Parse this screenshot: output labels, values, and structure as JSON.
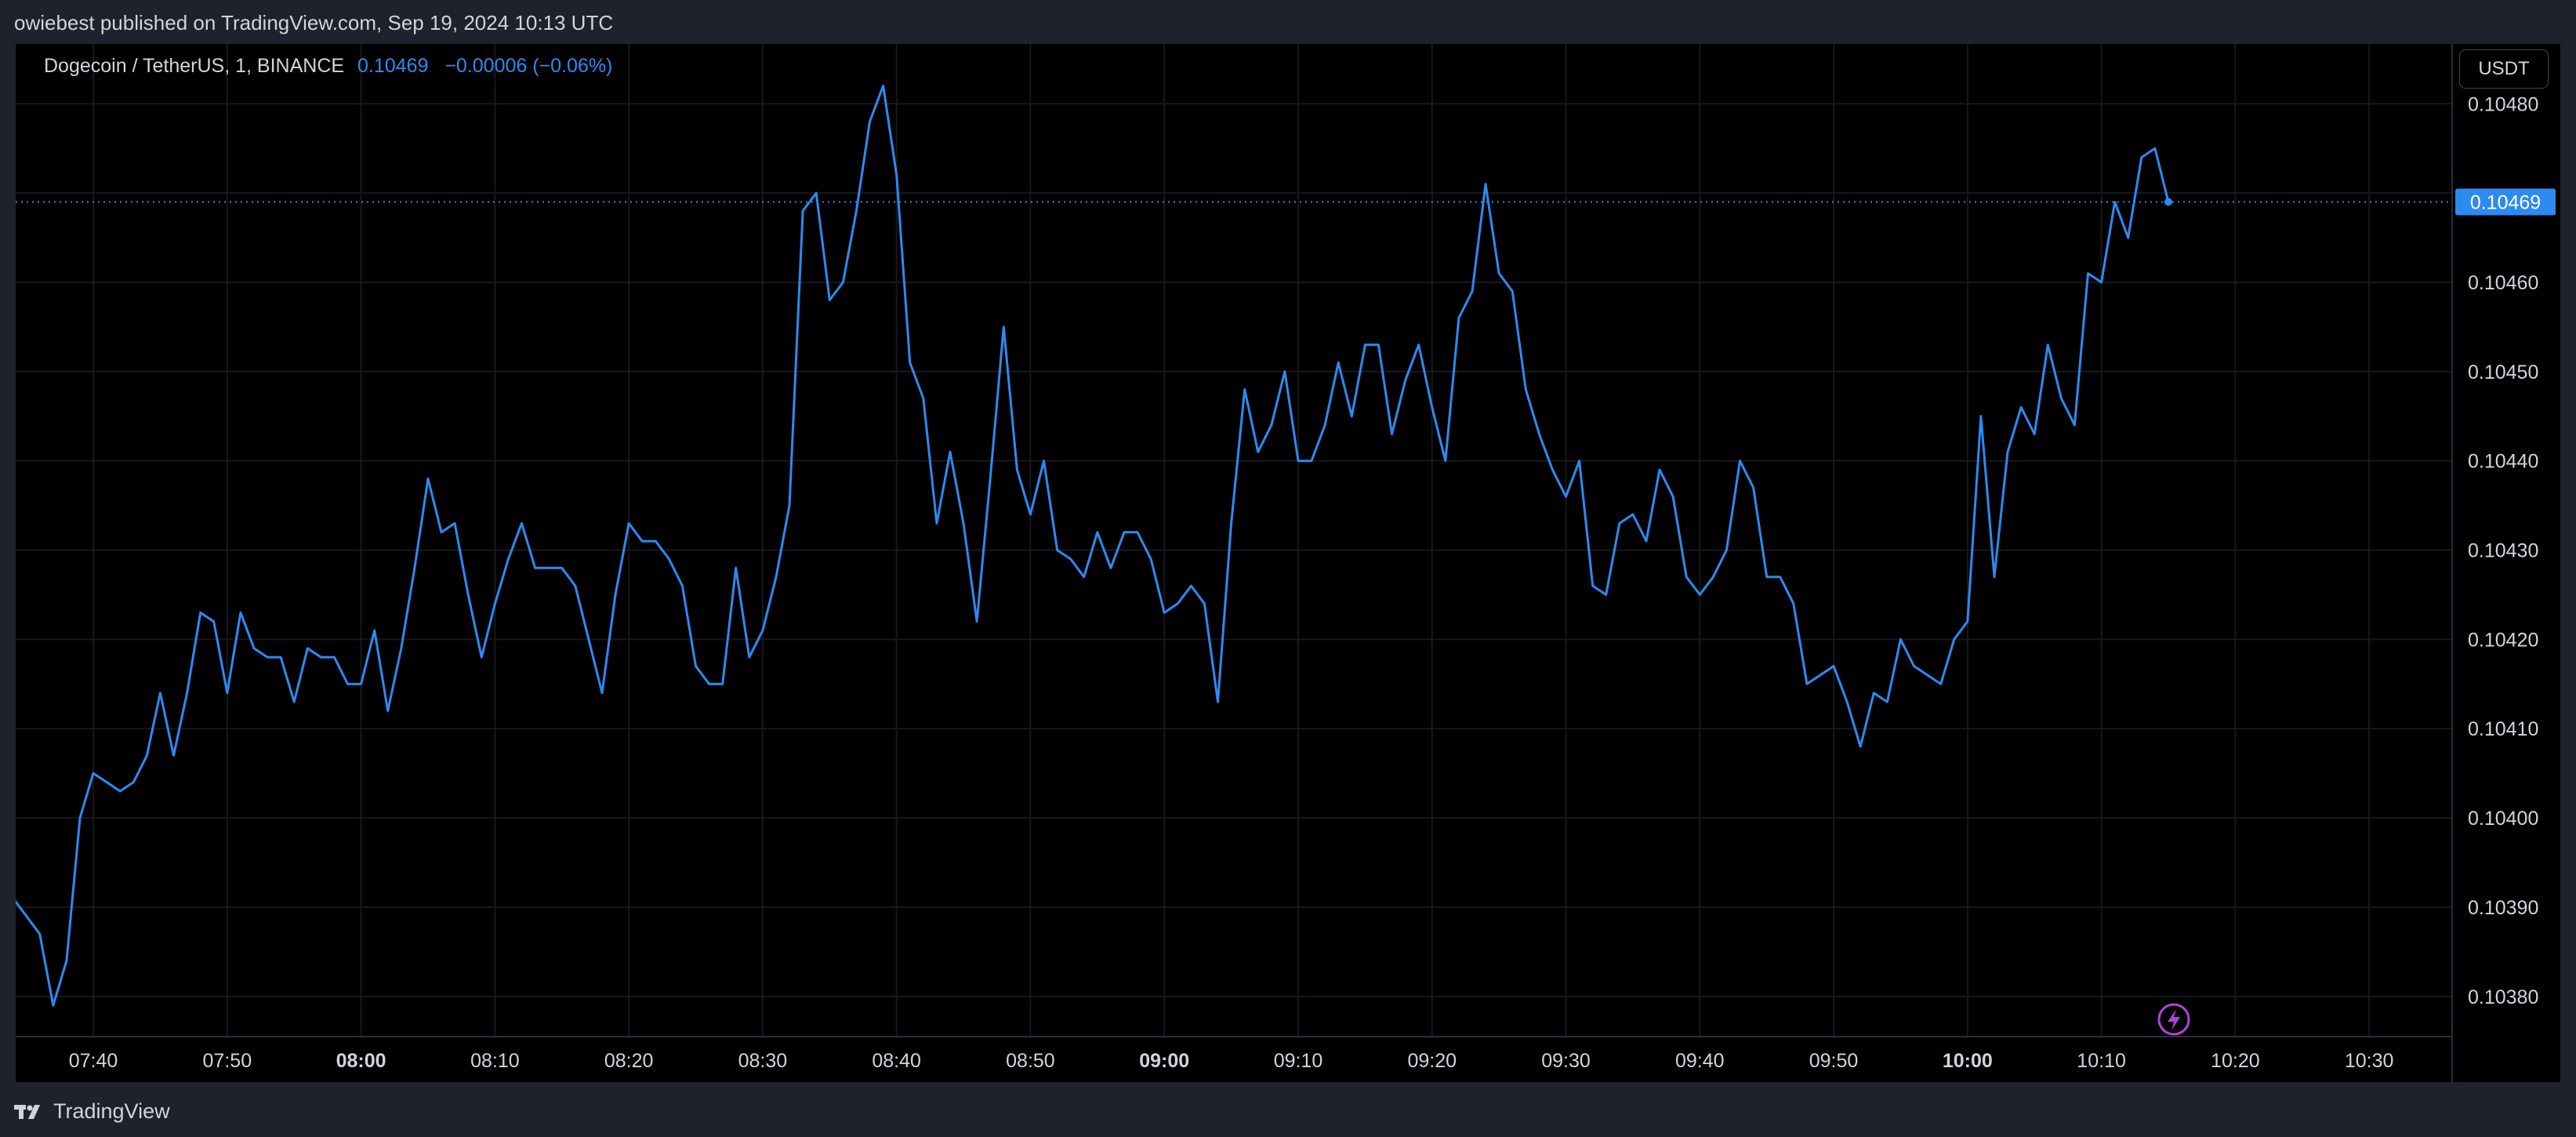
{
  "header": {
    "published": "owiebest published on TradingView.com, Sep 19, 2024 10:13 UTC"
  },
  "symbol": {
    "name": "Dogecoin / TetherUS, 1, BINANCE",
    "price": "0.10469",
    "change": "−0.00006 (−0.06%)"
  },
  "unit": "USDT",
  "footer": {
    "brand": "TradingView"
  },
  "colors": {
    "line": "#2d8af0",
    "background": "#000000",
    "flash_icon": "#b044d8"
  },
  "icons": {
    "logo": "tradingview-logo-icon",
    "flash": "lightning-bolt-icon"
  },
  "chart_data": {
    "type": "line",
    "title": "Dogecoin / TetherUS, 1, BINANCE",
    "xlabel": "",
    "ylabel": "",
    "grid": true,
    "last_value_label": "0.10469",
    "x_tick_labels": [
      {
        "label": "07:40",
        "min": 460,
        "bold": false
      },
      {
        "label": "07:50",
        "min": 470,
        "bold": false
      },
      {
        "label": "08:00",
        "min": 480,
        "bold": true
      },
      {
        "label": "08:10",
        "min": 490,
        "bold": false
      },
      {
        "label": "08:20",
        "min": 500,
        "bold": false
      },
      {
        "label": "08:30",
        "min": 510,
        "bold": false
      },
      {
        "label": "08:40",
        "min": 520,
        "bold": false
      },
      {
        "label": "08:50",
        "min": 530,
        "bold": false
      },
      {
        "label": "09:00",
        "min": 540,
        "bold": true
      },
      {
        "label": "09:10",
        "min": 550,
        "bold": false
      },
      {
        "label": "09:20",
        "min": 560,
        "bold": false
      },
      {
        "label": "09:30",
        "min": 570,
        "bold": false
      },
      {
        "label": "09:40",
        "min": 580,
        "bold": false
      },
      {
        "label": "09:50",
        "min": 590,
        "bold": false
      },
      {
        "label": "10:00",
        "min": 600,
        "bold": true
      },
      {
        "label": "10:10",
        "min": 610,
        "bold": false
      },
      {
        "label": "10:20",
        "min": 620,
        "bold": false
      },
      {
        "label": "10:30",
        "min": 630,
        "bold": false
      }
    ],
    "y_tick_labels": [
      "0.10380",
      "0.10390",
      "0.10400",
      "0.10410",
      "0.10420",
      "0.10430",
      "0.10440",
      "0.10450",
      "0.10460",
      "0.10480"
    ],
    "y_grid_values": [
      0.1038,
      0.1039,
      0.104,
      0.1041,
      0.1042,
      0.1043,
      0.1044,
      0.1045,
      0.1046,
      0.1047,
      0.1048
    ],
    "xlim": [
      454.2,
      636.2
    ],
    "ylim": [
      0.103755,
      0.104867
    ],
    "series": [
      {
        "start_min": 454,
        "step_min": 1,
        "values": [
          0.10391,
          0.10389,
          0.10387,
          0.10379,
          0.10384,
          0.104,
          0.10405,
          0.10404,
          0.10403,
          0.10404,
          0.10407,
          0.10414,
          0.10407,
          0.10414,
          0.10423,
          0.10422,
          0.10414,
          0.10423,
          0.10419,
          0.10418,
          0.10418,
          0.10413,
          0.10419,
          0.10418,
          0.10418,
          0.10415,
          0.10415,
          0.10421,
          0.10412,
          0.10419,
          0.10428,
          0.10438,
          0.10432,
          0.10433,
          0.10425,
          0.10418,
          0.10424,
          0.10429,
          0.10433,
          0.10428,
          0.10428,
          0.10428,
          0.10426,
          0.1042,
          0.10414,
          0.10425,
          0.10433,
          0.10431,
          0.10431,
          0.10429,
          0.10426,
          0.10417,
          0.10415,
          0.10415,
          0.10428,
          0.10418,
          0.10421,
          0.10427,
          0.10435,
          0.10468,
          0.1047,
          0.10458,
          0.1046,
          0.10468,
          0.10478,
          0.10482,
          0.10472,
          0.10451,
          0.10447,
          0.10433,
          0.10441,
          0.10433,
          0.10422,
          0.10438,
          0.10455,
          0.10439,
          0.10434,
          0.1044,
          0.1043,
          0.10429,
          0.10427,
          0.10432,
          0.10428,
          0.10432,
          0.10432,
          0.10429,
          0.10423,
          0.10424,
          0.10426,
          0.10424,
          0.10413,
          0.10433,
          0.10448,
          0.10441,
          0.10444,
          0.1045,
          0.1044,
          0.1044,
          0.10444,
          0.10451,
          0.10445,
          0.10453,
          0.10453,
          0.10443,
          0.10449,
          0.10453,
          0.10446,
          0.1044,
          0.10456,
          0.10459,
          0.10471,
          0.10461,
          0.10459,
          0.10448,
          0.10443,
          0.10439,
          0.10436,
          0.1044,
          0.10426,
          0.10425,
          0.10433,
          0.10434,
          0.10431,
          0.10439,
          0.10436,
          0.10427,
          0.10425,
          0.10427,
          0.1043,
          0.1044,
          0.10437,
          0.10427,
          0.10427,
          0.10424,
          0.10415,
          0.10416,
          0.10417,
          0.10413,
          0.10408,
          0.10414,
          0.10413,
          0.1042,
          0.10417,
          0.10416,
          0.10415,
          0.1042,
          0.10422,
          0.10445,
          0.10427,
          0.10441,
          0.10446,
          0.10443,
          0.10453,
          0.10447,
          0.10444,
          0.10461,
          0.1046,
          0.10469,
          0.10465,
          0.10474,
          0.10475,
          0.10469
        ]
      }
    ]
  }
}
